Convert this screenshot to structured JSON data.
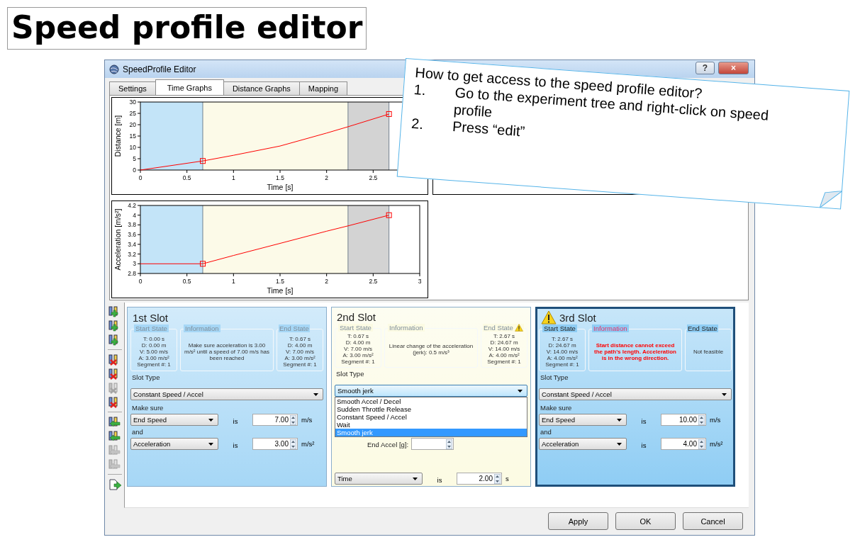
{
  "slide_title": "Speed profile editor",
  "window": {
    "title": "SpeedProfile Editor",
    "help": "?",
    "close": "×"
  },
  "tabs": [
    {
      "label": "Settings",
      "selected": false
    },
    {
      "label": "Time Graphs",
      "selected": true
    },
    {
      "label": "Distance Graphs",
      "selected": false
    },
    {
      "label": "Mapping",
      "selected": false
    }
  ],
  "charts": [
    {
      "chart_data": {
        "type": "line",
        "xlabel": "Time [s]",
        "ylabel": "Distance [m]",
        "xlim": [
          0,
          3
        ],
        "ylim": [
          0,
          30
        ],
        "xticks": [
          0,
          0.5,
          1,
          1.5,
          2,
          2.5
        ],
        "yticks": [
          0,
          5,
          10,
          15,
          20,
          25,
          30
        ],
        "x": [
          0,
          0.67,
          1,
          1.5,
          2,
          2.23,
          2.67
        ],
        "series": [
          {
            "color": "#ff0000",
            "values": [
              0,
              4,
              6.5,
              10.6,
              16.3,
              19.1,
              24.7
            ]
          }
        ],
        "bands": [
          {
            "axis": "x",
            "from": 0,
            "to": 0.67,
            "color": "#c3e4f8"
          },
          {
            "axis": "x",
            "from": 0.67,
            "to": 2.23,
            "color": "#fcfae8"
          },
          {
            "axis": "x",
            "from": 2.23,
            "to": 2.67,
            "color": "#d3d3d3"
          }
        ]
      }
    },
    {
      "chart_data": {
        "type": "line",
        "xlabel": "Time [s]",
        "ylabel": "Acceleration [m/s²]",
        "xlim": [
          0,
          3
        ],
        "ylim": [
          2.8,
          4.2
        ],
        "xticks": [
          0,
          0.5,
          1,
          1.5,
          2,
          2.5,
          3
        ],
        "yticks": [
          2.8,
          3,
          3.2,
          3.4,
          3.6,
          3.8,
          4,
          4.2
        ],
        "x": [
          0,
          0.67,
          1,
          1.5,
          2,
          2.23,
          2.67
        ],
        "series": [
          {
            "color": "#ff0000",
            "values": [
              3,
              3,
              3.17,
              3.42,
              3.67,
              3.78,
              4
            ]
          }
        ],
        "bands": [
          {
            "axis": "x",
            "from": 0,
            "to": 0.67,
            "color": "#c3e4f8"
          },
          {
            "axis": "x",
            "from": 0.67,
            "to": 2.23,
            "color": "#fcfae8"
          },
          {
            "axis": "x",
            "from": 2.23,
            "to": 2.67,
            "color": "#d3d3d3"
          }
        ]
      }
    }
  ],
  "toolbar": [
    {
      "kind": "add",
      "disabled": false
    },
    {
      "kind": "add",
      "disabled": false
    },
    {
      "kind": "add",
      "disabled": false
    },
    {
      "kind": "delete",
      "disabled": false
    },
    {
      "kind": "delete",
      "disabled": false
    },
    {
      "kind": "delete",
      "disabled": true
    },
    {
      "kind": "delete",
      "disabled": false
    },
    {
      "kind": "move",
      "disabled": false
    },
    {
      "kind": "move",
      "disabled": false
    },
    {
      "kind": "move",
      "disabled": true
    },
    {
      "kind": "move",
      "disabled": true
    },
    {
      "kind": "export",
      "disabled": false
    }
  ],
  "slots": [
    {
      "title": "1st Slot",
      "selected": false,
      "warning": false,
      "color": "#a6d7f6",
      "start": {
        "label": "Start State",
        "lines": [
          "T: 0.00 s",
          "D: 0.00 m",
          "V: 5.00 m/s",
          "A: 3.00 m/s²",
          "Segment #: 1"
        ]
      },
      "info": {
        "label": "Information",
        "text": "Make sure acceleration is 3.00 m/s² until a speed of 7.00 m/s has been reached",
        "error": false
      },
      "end": {
        "label": "End State",
        "warning": false,
        "lines": [
          "T: 0.67 s",
          "D: 4.00 m",
          "V: 7.00 m/s",
          "A: 3.00 m/s²",
          "Segment #: 1"
        ]
      },
      "type_label": "Slot Type",
      "type": {
        "value": "Constant Speed / Accel",
        "expanded": false
      },
      "rows": [
        {
          "kind": "label",
          "text": "Make sure"
        },
        {
          "kind": "condition",
          "field": "End Speed",
          "is": "is",
          "value": "7.00",
          "unit": "m/s"
        },
        {
          "kind": "label",
          "text": "and"
        },
        {
          "kind": "condition",
          "field": "Acceleration",
          "is": "is",
          "value": "3.00",
          "unit": "m/s²"
        }
      ]
    },
    {
      "title": "2nd Slot",
      "selected": false,
      "warning": false,
      "color": "#fcfbe3",
      "start": {
        "label": "Start State",
        "lines": [
          "T: 0.67 s",
          "D: 4.00 m",
          "V: 7.00 m/s",
          "A: 3.00 m/s²",
          "Segment #: 1"
        ]
      },
      "info": {
        "label": "Information",
        "text": "Linear change of the acceleration (jerk): 0.5 m/s³",
        "error": false
      },
      "end": {
        "label": "End State",
        "warning": true,
        "lines": [
          "T: 2.67 s",
          "D: 24.67 m",
          "V: 14.00 m/s",
          "A: 4.00 m/s²",
          "Segment #: 1"
        ]
      },
      "type_label": "Slot Type",
      "type": {
        "value": "Smooth jerk",
        "expanded": true,
        "options": [
          {
            "label": "Smooth Accel / Decel",
            "selected": false
          },
          {
            "label": "Sudden Throttle Release",
            "selected": false
          },
          {
            "label": "Constant Speed / Accel",
            "selected": false
          },
          {
            "label": "Wait",
            "selected": false
          },
          {
            "label": "Smooth jerk",
            "selected": true
          }
        ]
      },
      "rows": [
        {
          "kind": "spin",
          "text": "End Accel [g]:"
        },
        {
          "kind": "condition",
          "field": "Time",
          "is": "is",
          "value": "2.00",
          "unit": "s"
        }
      ]
    },
    {
      "title": "3rd Slot",
      "selected": true,
      "warning": true,
      "color": "#8fcdf4",
      "start": {
        "label": "Start State",
        "lines": [
          "T: 2.67 s",
          "D: 24.67 m",
          "V: 14.00 m/s",
          "A: 4.00 m/s²",
          "Segment #: 1"
        ]
      },
      "info": {
        "label": "Information",
        "text": "Start distance cannot exceed the path's length. Acceleration is in the wrong direction.",
        "error": true
      },
      "end": {
        "label": "End State",
        "warning": false,
        "lines": [
          "Not feasible"
        ]
      },
      "type_label": "Slot Type",
      "type": {
        "value": "Constant Speed / Accel",
        "expanded": false
      },
      "rows": [
        {
          "kind": "label",
          "text": "Make sure"
        },
        {
          "kind": "condition",
          "field": "End Speed",
          "is": "is",
          "value": "10.00",
          "unit": "m/s"
        },
        {
          "kind": "label",
          "text": "and"
        },
        {
          "kind": "condition",
          "field": "Acceleration",
          "is": "is",
          "value": "4.00",
          "unit": "m/s²"
        }
      ]
    }
  ],
  "buttons": [
    "Apply",
    "OK",
    "Cancel"
  ],
  "note": {
    "title": "How to get access to the speed profile editor?",
    "steps": [
      {
        "number": "1.",
        "text": "Go to the experiment tree and right-click on speed profile"
      },
      {
        "number": "2.",
        "text": "Press “edit”"
      }
    ]
  }
}
